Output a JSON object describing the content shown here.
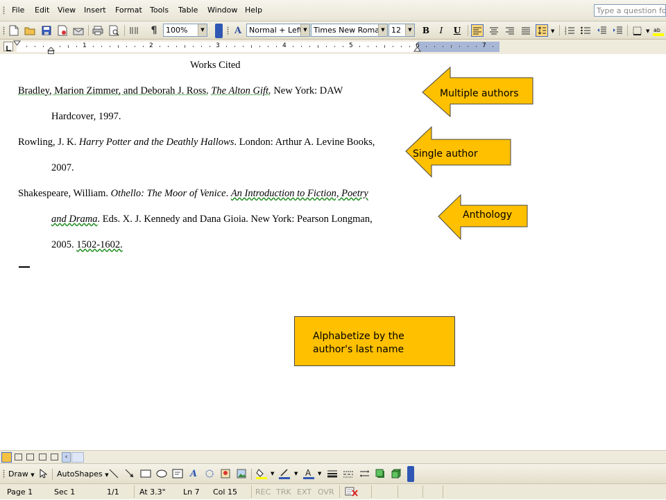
{
  "menu": {
    "items": [
      "File",
      "Edit",
      "View",
      "Insert",
      "Format",
      "Tools",
      "Table",
      "Window",
      "Help"
    ],
    "help_placeholder": "Type a question for help"
  },
  "toolbar": {
    "zoom": "100%",
    "style": "Normal + Left:",
    "font": "Times New Roman",
    "size": "12"
  },
  "ruler": {
    "numbers": [
      "1",
      "2",
      "3",
      "4",
      "5",
      "6",
      "7"
    ]
  },
  "document": {
    "heading": "Works Cited",
    "entries": {
      "e1_a": "Bradley, Marion Zimmer, and Deborah J. Ross.",
      "e1_b": "The Alton Gift.",
      "e1_c": "New York: DAW",
      "e1_l2": "Hardcover, 1997.",
      "e2_a": "Rowling, J. K.",
      "e2_b": "Harry Potter and the Deathly Hallows",
      "e2_c": ". London: Arthur A. Levine Books,",
      "e2_l2": "2007.",
      "e3_a": "Shakespeare, William.",
      "e3_b": "Othello",
      "e3_c": ": The Moor of Venice",
      "e3_d": ".",
      "e3_e": "An Introduction to Fiction, Poetry",
      "e3_f": "and Drama",
      "e3_g": ". Eds. X. J. Kennedy and Dana Gioia. New York: Pearson Longman,",
      "e3_h": "2005.",
      "e3_i": "1502-1602."
    }
  },
  "callouts": {
    "multiple_authors": "Multiple authors",
    "single_author": "Single author",
    "anthology": "Anthology",
    "alphabetize_line1": "Alphabetize by the",
    "alphabetize_line2": "author's last name",
    "fill": "#ffc000",
    "stroke": "#444444"
  },
  "drawbar": {
    "draw": "Draw",
    "autoshapes": "AutoShapes"
  },
  "status": {
    "page": "Page 1",
    "sec": "Sec 1",
    "pages": "1/1",
    "at": "At 3.3\"",
    "ln": "Ln 7",
    "col": "Col 15",
    "rec": "REC",
    "trk": "TRK",
    "ext": "EXT",
    "ovr": "OVR"
  }
}
